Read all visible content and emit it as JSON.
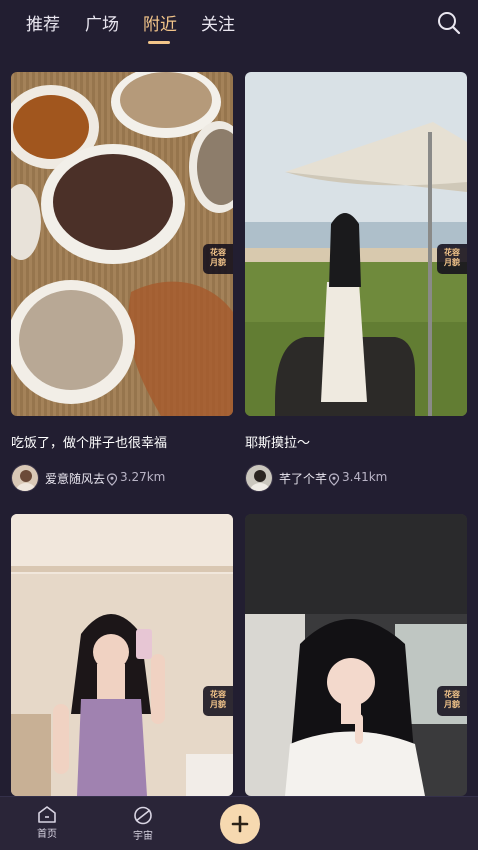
{
  "tabs": [
    {
      "label": "推荐",
      "active": false
    },
    {
      "label": "广场",
      "active": false
    },
    {
      "label": "附近",
      "active": true
    },
    {
      "label": "关注",
      "active": false
    }
  ],
  "search_icon": "search-icon",
  "colors": {
    "background": "#221e31",
    "accent": "#f3c58a",
    "fab": "#f6d9b0",
    "bottom_bar": "#2a2538"
  },
  "posts": [
    {
      "caption": "吃饭了，做个胖子也很幸福",
      "username": "爱意随风去",
      "distance": "3.27km",
      "badge": "花容月貌"
    },
    {
      "caption": "耶斯摸拉～",
      "username": "芊了个芊",
      "distance": "3.41km",
      "badge": "花容月貌"
    },
    {
      "caption": "",
      "username": "",
      "distance": "",
      "badge": "花容月貌"
    },
    {
      "caption": "",
      "username": "",
      "distance": "",
      "badge": "花容月貌"
    }
  ],
  "bottom_nav": [
    {
      "label": "首页",
      "icon": "home-icon"
    },
    {
      "label": "宇宙",
      "icon": "planet-icon"
    }
  ],
  "fab_icon": "plus-icon"
}
